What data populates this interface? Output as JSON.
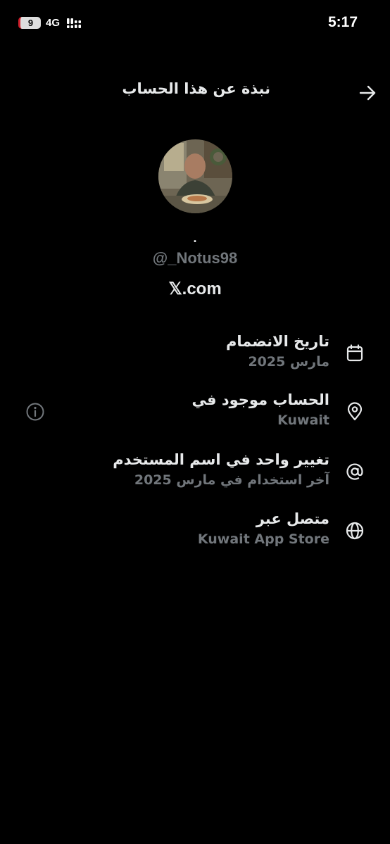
{
  "status_bar": {
    "battery": "9",
    "network": "4G",
    "time": "5:17"
  },
  "header": {
    "title": "نبذة عن هذا الحساب",
    "back_icon": "arrow-right-icon"
  },
  "profile": {
    "display_name": ".",
    "handle": "@_Notus98",
    "verified_via": "𝕏.com"
  },
  "rows": [
    {
      "icon": "calendar-icon",
      "title": "تاريخ الانضمام",
      "subtitle": "مارس 2025"
    },
    {
      "icon": "location-pin-icon",
      "title": "الحساب موجود في",
      "subtitle": "Kuwait",
      "extra_icon": "info-icon"
    },
    {
      "icon": "at-sign-icon",
      "title": "تغيير واحد في اسم المستخدم",
      "subtitle": "آخر استخدام في مارس 2025"
    },
    {
      "icon": "globe-icon",
      "title": "متصل عبر",
      "subtitle": "Kuwait App Store"
    }
  ],
  "colors": {
    "background": "#000000",
    "primary_text": "#e7e9ea",
    "secondary_text": "#71767b",
    "battery_low": "#d01f2b"
  }
}
